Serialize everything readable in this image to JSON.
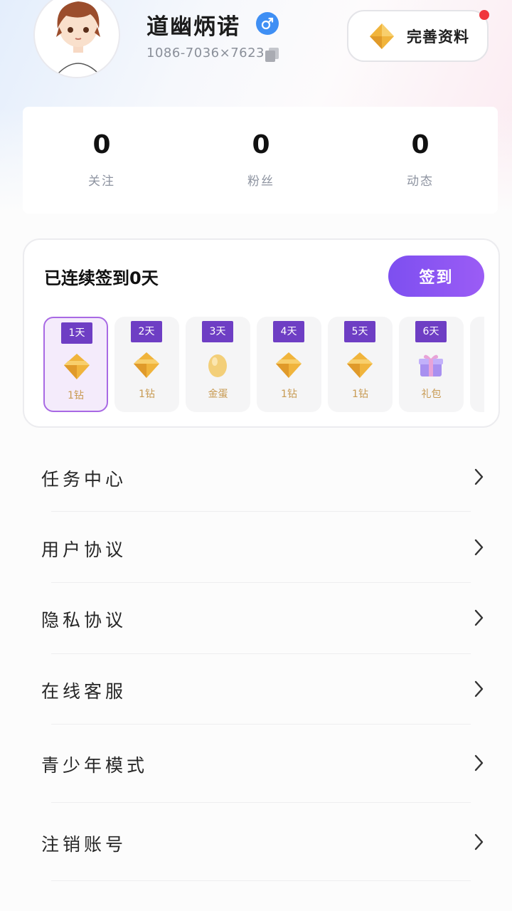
{
  "profile": {
    "nickname": "道幽炳诺",
    "user_id": "1086-7036×7623",
    "complete_label": "完善资料",
    "gender_icon": "male-icon"
  },
  "stats": [
    {
      "value": "0",
      "label": "关注"
    },
    {
      "value": "0",
      "label": "粉丝"
    },
    {
      "value": "0",
      "label": "动态"
    }
  ],
  "checkin": {
    "title": "已连续签到0天",
    "button_label": "签到",
    "days": [
      {
        "day": "1天",
        "reward": "1钻",
        "icon": "diamond-icon",
        "active": true
      },
      {
        "day": "2天",
        "reward": "1钻",
        "icon": "diamond-icon",
        "active": false
      },
      {
        "day": "3天",
        "reward": "金蛋",
        "icon": "golden-egg-icon",
        "active": false
      },
      {
        "day": "4天",
        "reward": "1钻",
        "icon": "diamond-icon",
        "active": false
      },
      {
        "day": "5天",
        "reward": "1钻",
        "icon": "diamond-icon",
        "active": false
      },
      {
        "day": "6天",
        "reward": "礼包",
        "icon": "gift-box-icon",
        "active": false
      }
    ]
  },
  "menu": [
    {
      "label": "任务中心"
    },
    {
      "label": "用户协议"
    },
    {
      "label": "隐私协议"
    },
    {
      "label": "在线客服"
    },
    {
      "label": "青少年模式"
    },
    {
      "label": "注销账号"
    }
  ],
  "colors": {
    "accent": "#8a55f3",
    "tag": "#6e3ec4",
    "gender": "#3f8ff4",
    "badge": "#f0363d",
    "reward_text": "#c89a52"
  }
}
